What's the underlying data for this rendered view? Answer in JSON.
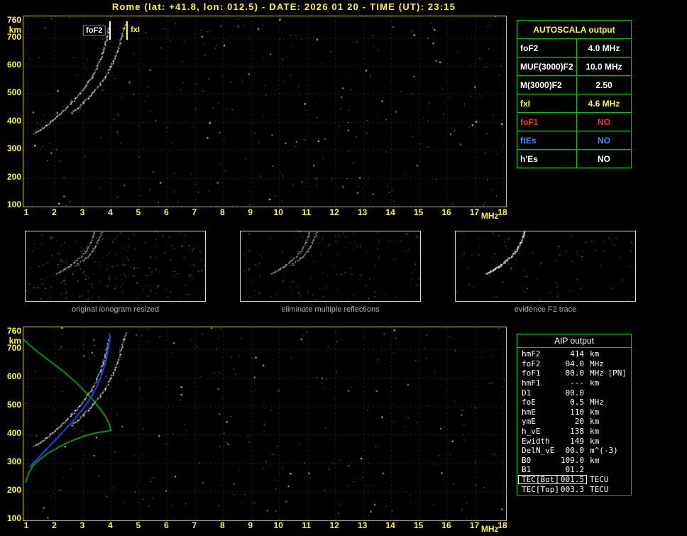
{
  "header": {
    "title": "Rome (lat: +41.8, lon: 012.5) - DATE: 2026 01 20 - TIME (UT): 23:15"
  },
  "colors": {
    "axis": "#ffff00",
    "plot_border": "#c9c900",
    "table_border": "#00c800",
    "trace": "#ffffff",
    "profile_green": "#00c81e",
    "restored_blue": "#2742ff",
    "no_red": "#ff2a2a",
    "es_blue": "#3c8cff"
  },
  "autoscala_panel": {
    "title": "AUTOSCALA output",
    "rows": [
      {
        "label": "foF2",
        "value": "4.0 MHz",
        "color": "#ffffff"
      },
      {
        "label": "MUF(3000)F2",
        "value": "10.0 MHz",
        "color": "#ffffff"
      },
      {
        "label": "M(3000)F2",
        "value": "2.50",
        "color": "#ffffff"
      },
      {
        "label": "fxI",
        "value": "4.6 MHz",
        "color": "#ffff00"
      },
      {
        "label": "foF1",
        "value": "NO",
        "color": "#ff2a2a"
      },
      {
        "label": "ftEs",
        "value": "NO",
        "color": "#3c8cff"
      },
      {
        "label": "h'Es",
        "value": "NO",
        "color": "#ffffff"
      }
    ]
  },
  "thumbnails": [
    {
      "caption": "original ionogram resized",
      "series": [
        "o-trace",
        "x-trace"
      ],
      "noise": 230,
      "dot": 1.3,
      "seed": 31
    },
    {
      "caption": "eliminate multiple reflections",
      "series": [
        "o-trace",
        "x-trace"
      ],
      "noise": 115,
      "dot": 1.3,
      "seed": 37
    },
    {
      "caption": "evidence F2 trace",
      "series": [
        "o-trace"
      ],
      "noise": 95,
      "dot": 2,
      "seed": 41
    }
  ],
  "aip_panel": {
    "title": "AIP output",
    "rows": [
      {
        "name": "hmF2",
        "value": "414",
        "unit": "km",
        "note": ""
      },
      {
        "name": "foF2",
        "value": "04.0",
        "unit": "MHz",
        "note": ""
      },
      {
        "name": "foF1",
        "value": "00.0",
        "unit": "MHz",
        "note": "[PN]"
      },
      {
        "name": "hmF1",
        "value": "---",
        "unit": "km",
        "note": ""
      },
      {
        "name": "D1",
        "value": "00.0",
        "unit": "",
        "note": ""
      },
      {
        "name": "foE",
        "value": "0.5",
        "unit": "MHz",
        "note": ""
      },
      {
        "name": "hmE",
        "value": "110",
        "unit": "km",
        "note": ""
      },
      {
        "name": "ymE",
        "value": "20",
        "unit": "km",
        "note": ""
      },
      {
        "name": "h_vE",
        "value": "138",
        "unit": "km",
        "note": ""
      },
      {
        "name": "Ewidth",
        "value": "149",
        "unit": "km",
        "note": ""
      },
      {
        "name": "DelN_vE",
        "value": "00.0",
        "unit": "m^(-3)",
        "note": ""
      },
      {
        "name": "B0",
        "value": "109.0",
        "unit": "km",
        "note": ""
      },
      {
        "name": "B1",
        "value": "01.2",
        "unit": "",
        "note": ""
      },
      {
        "name": "TEC[Bot]",
        "value": "001.5",
        "unit": "TECU",
        "note": "",
        "highlight": true
      },
      {
        "name": "TEC[Top]",
        "value": "003.3",
        "unit": "TECU",
        "note": ""
      }
    ]
  },
  "chart_data": [
    {
      "id": "main_ionogram",
      "type": "scatter",
      "x_unit": "MHz",
      "y_unit": "km",
      "xlim": [
        1,
        18
      ],
      "ylim": [
        100,
        760
      ],
      "x_ticks": [
        1,
        2,
        3,
        4,
        5,
        6,
        7,
        8,
        9,
        10,
        11,
        12,
        13,
        14,
        15,
        16,
        17,
        18
      ],
      "y_ticks": [
        760,
        700,
        600,
        500,
        400,
        300,
        200,
        100
      ],
      "y_grid": [
        700,
        600,
        500,
        400,
        300,
        200,
        100
      ],
      "noise": {
        "seed": 11,
        "count": 330
      },
      "markers": [
        {
          "name": "foF2",
          "freq": 4.0,
          "color": "#ffffff",
          "boxed": true
        },
        {
          "name": "fxI",
          "freq": 4.6,
          "color": "#ffff00",
          "boxed": false
        }
      ],
      "series": [
        {
          "name": "o-trace",
          "style": "dots",
          "color": "#ffffff",
          "points": [
            [
              1.25,
              358
            ],
            [
              1.4,
              366
            ],
            [
              1.55,
              376
            ],
            [
              1.7,
              388
            ],
            [
              1.85,
              400
            ],
            [
              2.0,
              413
            ],
            [
              2.15,
              426
            ],
            [
              2.3,
              440
            ],
            [
              2.45,
              454
            ],
            [
              2.6,
              469
            ],
            [
              2.75,
              485
            ],
            [
              2.9,
              502
            ],
            [
              3.05,
              521
            ],
            [
              3.2,
              542
            ],
            [
              3.35,
              566
            ],
            [
              3.5,
              594
            ],
            [
              3.62,
              622
            ],
            [
              3.72,
              650
            ],
            [
              3.8,
              678
            ],
            [
              3.87,
              706
            ],
            [
              3.92,
              732
            ],
            [
              3.96,
              752
            ]
          ]
        },
        {
          "name": "x-trace",
          "style": "dots",
          "color": "#ffffff",
          "points": [
            [
              2.6,
              430
            ],
            [
              2.8,
              448
            ],
            [
              3.0,
              466
            ],
            [
              3.2,
              486
            ],
            [
              3.4,
              508
            ],
            [
              3.6,
              532
            ],
            [
              3.8,
              560
            ],
            [
              3.95,
              588
            ],
            [
              4.1,
              618
            ],
            [
              4.22,
              648
            ],
            [
              4.32,
              678
            ],
            [
              4.4,
              708
            ],
            [
              4.46,
              734
            ],
            [
              4.52,
              754
            ]
          ]
        }
      ]
    },
    {
      "id": "profile_ionogram",
      "type": "scatter",
      "x_unit": "MHz",
      "y_unit": "km",
      "xlim": [
        1,
        18
      ],
      "ylim": [
        100,
        760
      ],
      "x_ticks": [
        1,
        2,
        3,
        4,
        5,
        6,
        7,
        8,
        9,
        10,
        11,
        12,
        13,
        14,
        15,
        16,
        17,
        18
      ],
      "y_ticks": [
        760,
        700,
        600,
        500,
        400,
        300,
        200,
        100
      ],
      "y_grid": [
        700,
        600,
        500,
        400,
        300,
        200,
        100
      ],
      "noise": {
        "seed": 23,
        "count": 280
      },
      "markers": [],
      "series": [
        {
          "name": "o-trace",
          "style": "dots",
          "color": "#ffffff",
          "points": [
            [
              1.25,
              358
            ],
            [
              1.4,
              366
            ],
            [
              1.55,
              376
            ],
            [
              1.7,
              388
            ],
            [
              1.85,
              400
            ],
            [
              2.0,
              413
            ],
            [
              2.15,
              426
            ],
            [
              2.3,
              440
            ],
            [
              2.45,
              454
            ],
            [
              2.6,
              469
            ],
            [
              2.75,
              485
            ],
            [
              2.9,
              502
            ],
            [
              3.05,
              521
            ],
            [
              3.2,
              542
            ],
            [
              3.35,
              566
            ],
            [
              3.5,
              594
            ],
            [
              3.62,
              622
            ],
            [
              3.72,
              650
            ],
            [
              3.8,
              678
            ],
            [
              3.87,
              706
            ],
            [
              3.92,
              732
            ],
            [
              3.96,
              752
            ]
          ]
        },
        {
          "name": "x-trace",
          "style": "dots",
          "color": "#ffffff",
          "points": [
            [
              2.6,
              430
            ],
            [
              2.8,
              448
            ],
            [
              3.0,
              466
            ],
            [
              3.2,
              486
            ],
            [
              3.4,
              508
            ],
            [
              3.6,
              532
            ],
            [
              3.8,
              560
            ],
            [
              3.95,
              588
            ],
            [
              4.1,
              618
            ],
            [
              4.22,
              648
            ],
            [
              4.32,
              678
            ],
            [
              4.4,
              708
            ],
            [
              4.46,
              734
            ],
            [
              4.52,
              754
            ]
          ]
        },
        {
          "name": "electron-density-profile",
          "style": "line",
          "color": "#00c81e",
          "width": 1.5,
          "points": [
            [
              0.95,
              230
            ],
            [
              1.05,
              262
            ],
            [
              1.2,
              288
            ],
            [
              1.45,
              312
            ],
            [
              1.75,
              334
            ],
            [
              2.1,
              354
            ],
            [
              2.5,
              374
            ],
            [
              2.9,
              390
            ],
            [
              3.3,
              402
            ],
            [
              3.65,
              409
            ],
            [
              3.85,
              412
            ],
            [
              4.0,
              414
            ],
            [
              3.93,
              438
            ],
            [
              3.8,
              464
            ],
            [
              3.6,
              492
            ],
            [
              3.35,
              522
            ],
            [
              3.05,
              554
            ],
            [
              2.7,
              588
            ],
            [
              2.3,
              622
            ],
            [
              1.85,
              656
            ],
            [
              1.4,
              690
            ],
            [
              1.05,
              718
            ],
            [
              0.85,
              738
            ],
            [
              0.75,
              752
            ]
          ]
        },
        {
          "name": "restored-trace",
          "style": "line",
          "color": "#2742ff",
          "width": 2,
          "points": [
            [
              1.1,
              286
            ],
            [
              1.35,
              312
            ],
            [
              1.6,
              338
            ],
            [
              1.85,
              364
            ],
            [
              2.1,
              390
            ],
            [
              2.35,
              416
            ],
            [
              2.6,
              443
            ],
            [
              2.85,
              472
            ],
            [
              3.1,
              503
            ],
            [
              3.3,
              534
            ],
            [
              3.5,
              570
            ],
            [
              3.65,
              606
            ],
            [
              3.78,
              645
            ],
            [
              3.87,
              684
            ],
            [
              3.93,
              718
            ],
            [
              3.97,
              748
            ]
          ]
        }
      ]
    }
  ]
}
